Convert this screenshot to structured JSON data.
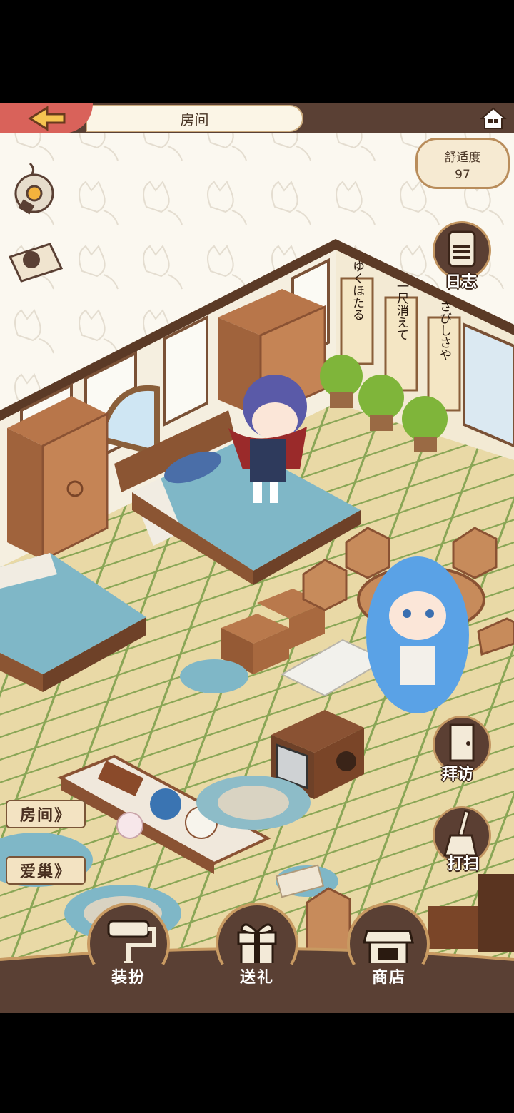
{
  "header": {
    "title": "房间"
  },
  "comfort": {
    "label": "舒适度",
    "value": "97"
  },
  "right_buttons": {
    "journal": "日志",
    "visit": "拜访",
    "clean": "打扫"
  },
  "side_tabs": {
    "room": "房间》",
    "nest": "爱巢》"
  },
  "bottom_nav": {
    "dress": "装扮",
    "gift": "送礼",
    "shop": "商店"
  },
  "scrolls": [
    "ゆくほたる",
    "一尺消えて",
    "さびしさや"
  ],
  "colors": {
    "header": "#5a4034",
    "back": "#d9625a",
    "tatami": "#e8d7a3",
    "accent": "#c39662"
  }
}
